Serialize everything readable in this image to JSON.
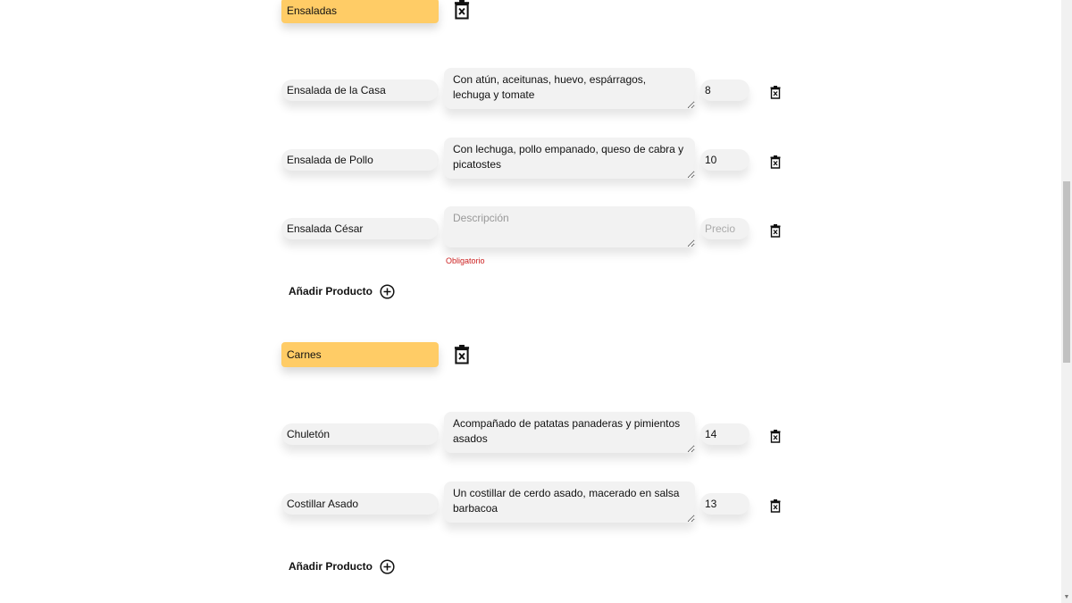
{
  "categories": [
    {
      "name": "Ensaladas",
      "products": [
        {
          "name": "Ensalada de la Casa",
          "description": "Con atún, aceitunas, huevo, espárragos, lechuga y tomate",
          "price": "8"
        },
        {
          "name": "Ensalada de Pollo",
          "description": "Con lechuga, pollo empanado, queso de cabra y picatostes",
          "price": "10"
        },
        {
          "name": "Ensalada César",
          "description": "",
          "price": "",
          "error": "Obligatorio"
        }
      ],
      "add_product_label": "Añadir Producto"
    },
    {
      "name": "Carnes",
      "products": [
        {
          "name": "Chuletón",
          "description": "Acompañado de patatas panaderas y pimientos asados",
          "price": "14"
        },
        {
          "name": "Costillar Asado",
          "description": "Un costillar de cerdo asado, macerado en salsa barbacoa",
          "price": "13"
        }
      ],
      "add_product_label": "Añadir Producto"
    }
  ],
  "placeholders": {
    "description": "Descripción",
    "price": "Precio"
  },
  "icons": {
    "delete": "trash-icon",
    "add": "plus-circle-icon"
  },
  "colors": {
    "category_bg": "#ffcc66",
    "field_bg": "#f2f2f2",
    "error": "#cc1f1f"
  }
}
